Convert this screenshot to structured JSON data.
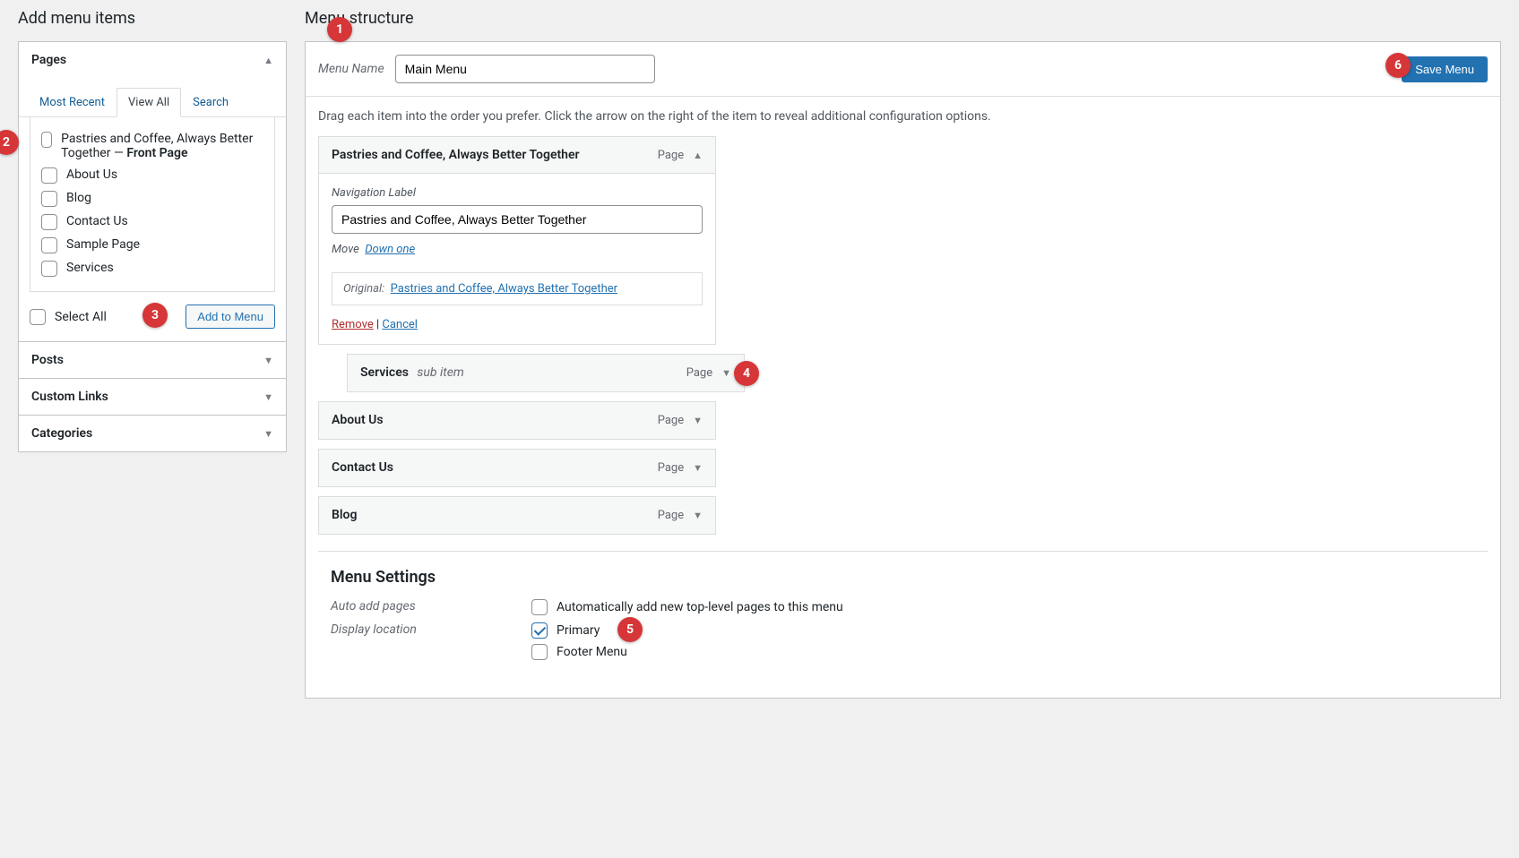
{
  "left": {
    "heading": "Add menu items",
    "pages_accordion": "Pages",
    "tabs": {
      "recent": "Most Recent",
      "all": "View All",
      "search": "Search"
    },
    "pages": [
      {
        "label": "Pastries and Coffee, Always Better Together — ",
        "front": "Front Page"
      },
      {
        "label": "About Us"
      },
      {
        "label": "Blog"
      },
      {
        "label": "Contact Us"
      },
      {
        "label": "Sample Page"
      },
      {
        "label": "Services"
      }
    ],
    "select_all": "Select All",
    "add_btn": "Add to Menu",
    "posts": "Posts",
    "custom_links": "Custom Links",
    "categories": "Categories"
  },
  "right": {
    "heading": "Menu structure",
    "menu_name_label": "Menu Name",
    "menu_name_value": "Main Menu",
    "save_btn": "Save Menu",
    "instruction": "Drag each item into the order you prefer. Click the arrow on the right of the item to reveal additional configuration options.",
    "type_label": "Page",
    "sub_label": "sub item",
    "item1": {
      "title": "Pastries and Coffee, Always Better Together",
      "nav_label_heading": "Navigation Label",
      "nav_label_value": "Pastries and Coffee, Always Better Together",
      "move_label": "Move",
      "move_link": "Down one",
      "original_label": "Original:",
      "original_link": "Pastries and Coffee, Always Better Together",
      "remove": "Remove",
      "cancel": "Cancel"
    },
    "items": [
      {
        "title": "Services",
        "sub": true
      },
      {
        "title": "About Us"
      },
      {
        "title": "Contact Us"
      },
      {
        "title": "Blog"
      }
    ],
    "settings": {
      "heading": "Menu Settings",
      "auto_label": "Auto add pages",
      "auto_opt": "Automatically add new top-level pages to this menu",
      "loc_label": "Display location",
      "loc_primary": "Primary",
      "loc_footer": "Footer Menu"
    }
  },
  "badges": {
    "b1": "1",
    "b2": "2",
    "b3": "3",
    "b4": "4",
    "b5": "5",
    "b6": "6"
  }
}
